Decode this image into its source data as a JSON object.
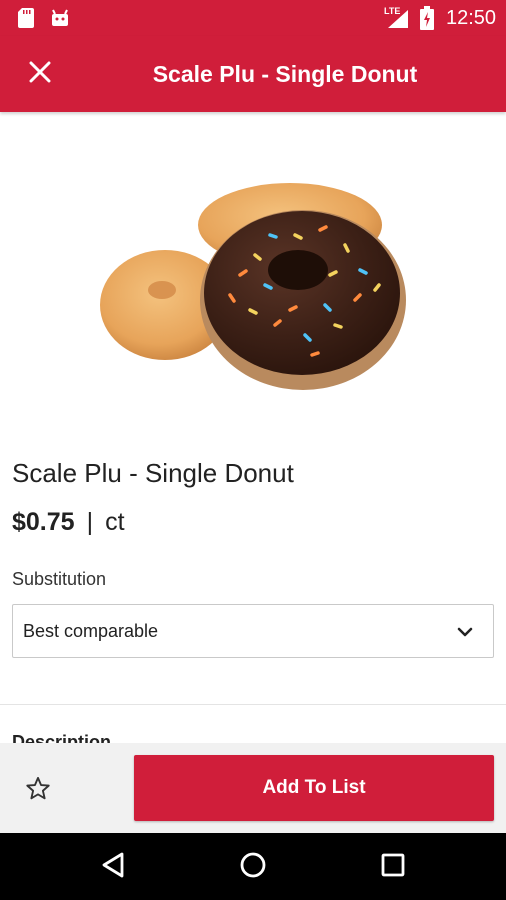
{
  "status_bar": {
    "time": "12:50",
    "network": "LTE",
    "icons": [
      "sd-card-icon",
      "android-icon",
      "signal-icon",
      "battery-icon"
    ]
  },
  "app_bar": {
    "title": "Scale Plu - Single Donut",
    "close_icon": "close-icon"
  },
  "product": {
    "name": "Scale Plu - Single Donut",
    "price": "$0.75",
    "separator": "|",
    "unit": "ct"
  },
  "substitution": {
    "label": "Substitution",
    "selected": "Best comparable"
  },
  "description": {
    "header": "Description"
  },
  "bottom_bar": {
    "favorite_icon": "star-outline-icon",
    "add_button": "Add To List"
  },
  "nav_bar": {
    "icons": [
      "back-icon",
      "home-icon",
      "recents-icon"
    ]
  },
  "colors": {
    "brand_red": "#d01e3a",
    "nav_black": "#000000",
    "bottom_bar_bg": "#f1f1f1"
  }
}
